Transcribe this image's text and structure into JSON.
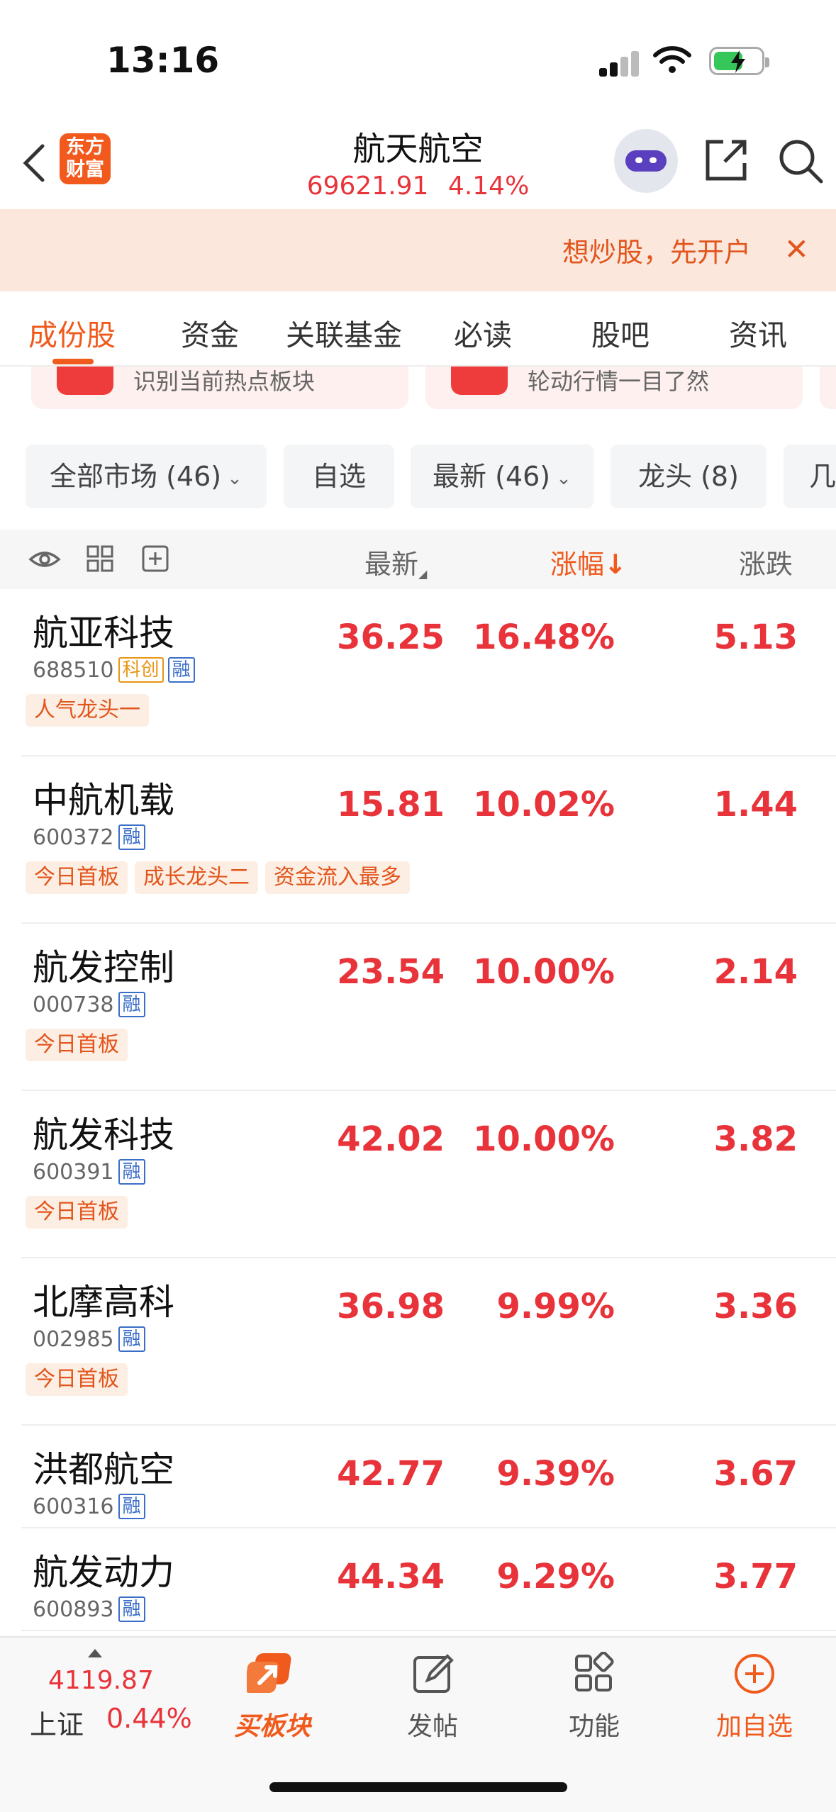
{
  "status": {
    "time": "13:16"
  },
  "header": {
    "logo_line1": "东方",
    "logo_line2": "财富",
    "title": "航天航空",
    "index_value": "69621.91",
    "index_change": "4.14%"
  },
  "banner": {
    "text": "想炒股，先开户"
  },
  "tabs": [
    "成份股",
    "资金",
    "关联基金",
    "必读",
    "股吧",
    "资讯"
  ],
  "peek_cards": [
    "识别当前热点板块",
    "轮动行情一目了然"
  ],
  "filters": {
    "all_market": "全部市场 (46)",
    "watchlist": "自选",
    "latest": "最新 (46)",
    "leaders": "龙头 (8)",
    "more": "几"
  },
  "table_header": {
    "latest": "最新",
    "change_pct": "涨幅",
    "change_amt": "涨跌"
  },
  "rows": [
    {
      "name": "航亚科技",
      "code": "688510",
      "kc": "科创",
      "rong": "融",
      "price": "36.25",
      "pct": "16.48%",
      "chg": "5.13",
      "tags": [
        "人气龙头一"
      ]
    },
    {
      "name": "中航机载",
      "code": "600372",
      "rong": "融",
      "price": "15.81",
      "pct": "10.02%",
      "chg": "1.44",
      "tags": [
        "今日首板",
        "成长龙头二",
        "资金流入最多"
      ]
    },
    {
      "name": "航发控制",
      "code": "000738",
      "rong": "融",
      "price": "23.54",
      "pct": "10.00%",
      "chg": "2.14",
      "tags": [
        "今日首板"
      ]
    },
    {
      "name": "航发科技",
      "code": "600391",
      "rong": "融",
      "price": "42.02",
      "pct": "10.00%",
      "chg": "3.82",
      "tags": [
        "今日首板"
      ]
    },
    {
      "name": "北摩高科",
      "code": "002985",
      "rong": "融",
      "price": "36.98",
      "pct": "9.99%",
      "chg": "3.36",
      "tags": [
        "今日首板"
      ]
    },
    {
      "name": "洪都航空",
      "code": "600316",
      "rong": "融",
      "price": "42.77",
      "pct": "9.39%",
      "chg": "3.67",
      "tags": []
    },
    {
      "name": "航发动力",
      "code": "600893",
      "rong": "融",
      "price": "44.34",
      "pct": "9.29%",
      "chg": "3.77",
      "tags": []
    }
  ],
  "bottom": {
    "index_value": "4119.87",
    "index_name": "上证",
    "index_pct": "0.44%",
    "buy_sector": "买板块",
    "post": "发帖",
    "functions": "功能",
    "add_watch": "加自选"
  },
  "colors": {
    "accent": "#f05a1c",
    "up_red": "#e8333a",
    "badge_blue": "#3a6ec8",
    "badge_orange": "#e89616"
  }
}
